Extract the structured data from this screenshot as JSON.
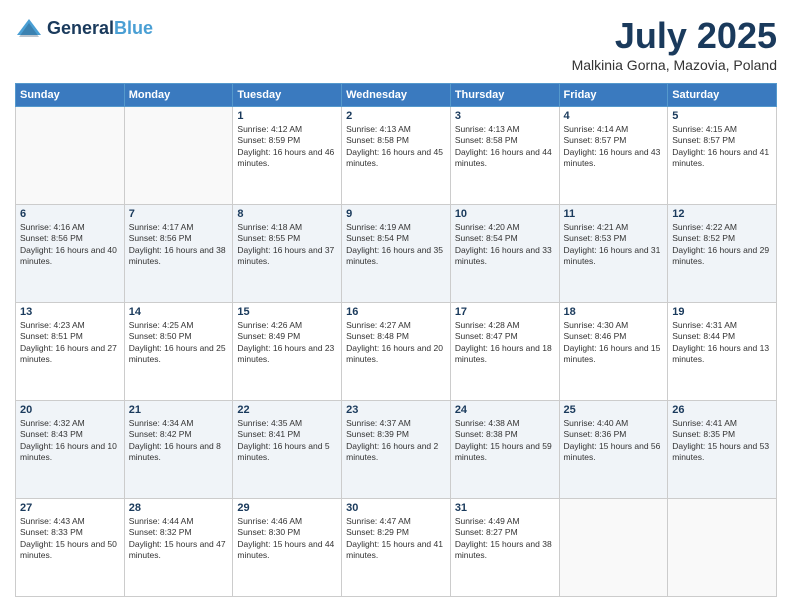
{
  "header": {
    "logo_line1": "General",
    "logo_line2": "Blue",
    "main_title": "July 2025",
    "subtitle": "Malkinia Gorna, Mazovia, Poland"
  },
  "weekdays": [
    "Sunday",
    "Monday",
    "Tuesday",
    "Wednesday",
    "Thursday",
    "Friday",
    "Saturday"
  ],
  "weeks": [
    [
      null,
      null,
      {
        "day": "1",
        "sunrise": "Sunrise: 4:12 AM",
        "sunset": "Sunset: 8:59 PM",
        "daylight": "Daylight: 16 hours and 46 minutes."
      },
      {
        "day": "2",
        "sunrise": "Sunrise: 4:13 AM",
        "sunset": "Sunset: 8:58 PM",
        "daylight": "Daylight: 16 hours and 45 minutes."
      },
      {
        "day": "3",
        "sunrise": "Sunrise: 4:13 AM",
        "sunset": "Sunset: 8:58 PM",
        "daylight": "Daylight: 16 hours and 44 minutes."
      },
      {
        "day": "4",
        "sunrise": "Sunrise: 4:14 AM",
        "sunset": "Sunset: 8:57 PM",
        "daylight": "Daylight: 16 hours and 43 minutes."
      },
      {
        "day": "5",
        "sunrise": "Sunrise: 4:15 AM",
        "sunset": "Sunset: 8:57 PM",
        "daylight": "Daylight: 16 hours and 41 minutes."
      }
    ],
    [
      {
        "day": "6",
        "sunrise": "Sunrise: 4:16 AM",
        "sunset": "Sunset: 8:56 PM",
        "daylight": "Daylight: 16 hours and 40 minutes."
      },
      {
        "day": "7",
        "sunrise": "Sunrise: 4:17 AM",
        "sunset": "Sunset: 8:56 PM",
        "daylight": "Daylight: 16 hours and 38 minutes."
      },
      {
        "day": "8",
        "sunrise": "Sunrise: 4:18 AM",
        "sunset": "Sunset: 8:55 PM",
        "daylight": "Daylight: 16 hours and 37 minutes."
      },
      {
        "day": "9",
        "sunrise": "Sunrise: 4:19 AM",
        "sunset": "Sunset: 8:54 PM",
        "daylight": "Daylight: 16 hours and 35 minutes."
      },
      {
        "day": "10",
        "sunrise": "Sunrise: 4:20 AM",
        "sunset": "Sunset: 8:54 PM",
        "daylight": "Daylight: 16 hours and 33 minutes."
      },
      {
        "day": "11",
        "sunrise": "Sunrise: 4:21 AM",
        "sunset": "Sunset: 8:53 PM",
        "daylight": "Daylight: 16 hours and 31 minutes."
      },
      {
        "day": "12",
        "sunrise": "Sunrise: 4:22 AM",
        "sunset": "Sunset: 8:52 PM",
        "daylight": "Daylight: 16 hours and 29 minutes."
      }
    ],
    [
      {
        "day": "13",
        "sunrise": "Sunrise: 4:23 AM",
        "sunset": "Sunset: 8:51 PM",
        "daylight": "Daylight: 16 hours and 27 minutes."
      },
      {
        "day": "14",
        "sunrise": "Sunrise: 4:25 AM",
        "sunset": "Sunset: 8:50 PM",
        "daylight": "Daylight: 16 hours and 25 minutes."
      },
      {
        "day": "15",
        "sunrise": "Sunrise: 4:26 AM",
        "sunset": "Sunset: 8:49 PM",
        "daylight": "Daylight: 16 hours and 23 minutes."
      },
      {
        "day": "16",
        "sunrise": "Sunrise: 4:27 AM",
        "sunset": "Sunset: 8:48 PM",
        "daylight": "Daylight: 16 hours and 20 minutes."
      },
      {
        "day": "17",
        "sunrise": "Sunrise: 4:28 AM",
        "sunset": "Sunset: 8:47 PM",
        "daylight": "Daylight: 16 hours and 18 minutes."
      },
      {
        "day": "18",
        "sunrise": "Sunrise: 4:30 AM",
        "sunset": "Sunset: 8:46 PM",
        "daylight": "Daylight: 16 hours and 15 minutes."
      },
      {
        "day": "19",
        "sunrise": "Sunrise: 4:31 AM",
        "sunset": "Sunset: 8:44 PM",
        "daylight": "Daylight: 16 hours and 13 minutes."
      }
    ],
    [
      {
        "day": "20",
        "sunrise": "Sunrise: 4:32 AM",
        "sunset": "Sunset: 8:43 PM",
        "daylight": "Daylight: 16 hours and 10 minutes."
      },
      {
        "day": "21",
        "sunrise": "Sunrise: 4:34 AM",
        "sunset": "Sunset: 8:42 PM",
        "daylight": "Daylight: 16 hours and 8 minutes."
      },
      {
        "day": "22",
        "sunrise": "Sunrise: 4:35 AM",
        "sunset": "Sunset: 8:41 PM",
        "daylight": "Daylight: 16 hours and 5 minutes."
      },
      {
        "day": "23",
        "sunrise": "Sunrise: 4:37 AM",
        "sunset": "Sunset: 8:39 PM",
        "daylight": "Daylight: 16 hours and 2 minutes."
      },
      {
        "day": "24",
        "sunrise": "Sunrise: 4:38 AM",
        "sunset": "Sunset: 8:38 PM",
        "daylight": "Daylight: 15 hours and 59 minutes."
      },
      {
        "day": "25",
        "sunrise": "Sunrise: 4:40 AM",
        "sunset": "Sunset: 8:36 PM",
        "daylight": "Daylight: 15 hours and 56 minutes."
      },
      {
        "day": "26",
        "sunrise": "Sunrise: 4:41 AM",
        "sunset": "Sunset: 8:35 PM",
        "daylight": "Daylight: 15 hours and 53 minutes."
      }
    ],
    [
      {
        "day": "27",
        "sunrise": "Sunrise: 4:43 AM",
        "sunset": "Sunset: 8:33 PM",
        "daylight": "Daylight: 15 hours and 50 minutes."
      },
      {
        "day": "28",
        "sunrise": "Sunrise: 4:44 AM",
        "sunset": "Sunset: 8:32 PM",
        "daylight": "Daylight: 15 hours and 47 minutes."
      },
      {
        "day": "29",
        "sunrise": "Sunrise: 4:46 AM",
        "sunset": "Sunset: 8:30 PM",
        "daylight": "Daylight: 15 hours and 44 minutes."
      },
      {
        "day": "30",
        "sunrise": "Sunrise: 4:47 AM",
        "sunset": "Sunset: 8:29 PM",
        "daylight": "Daylight: 15 hours and 41 minutes."
      },
      {
        "day": "31",
        "sunrise": "Sunrise: 4:49 AM",
        "sunset": "Sunset: 8:27 PM",
        "daylight": "Daylight: 15 hours and 38 minutes."
      },
      null,
      null
    ]
  ]
}
